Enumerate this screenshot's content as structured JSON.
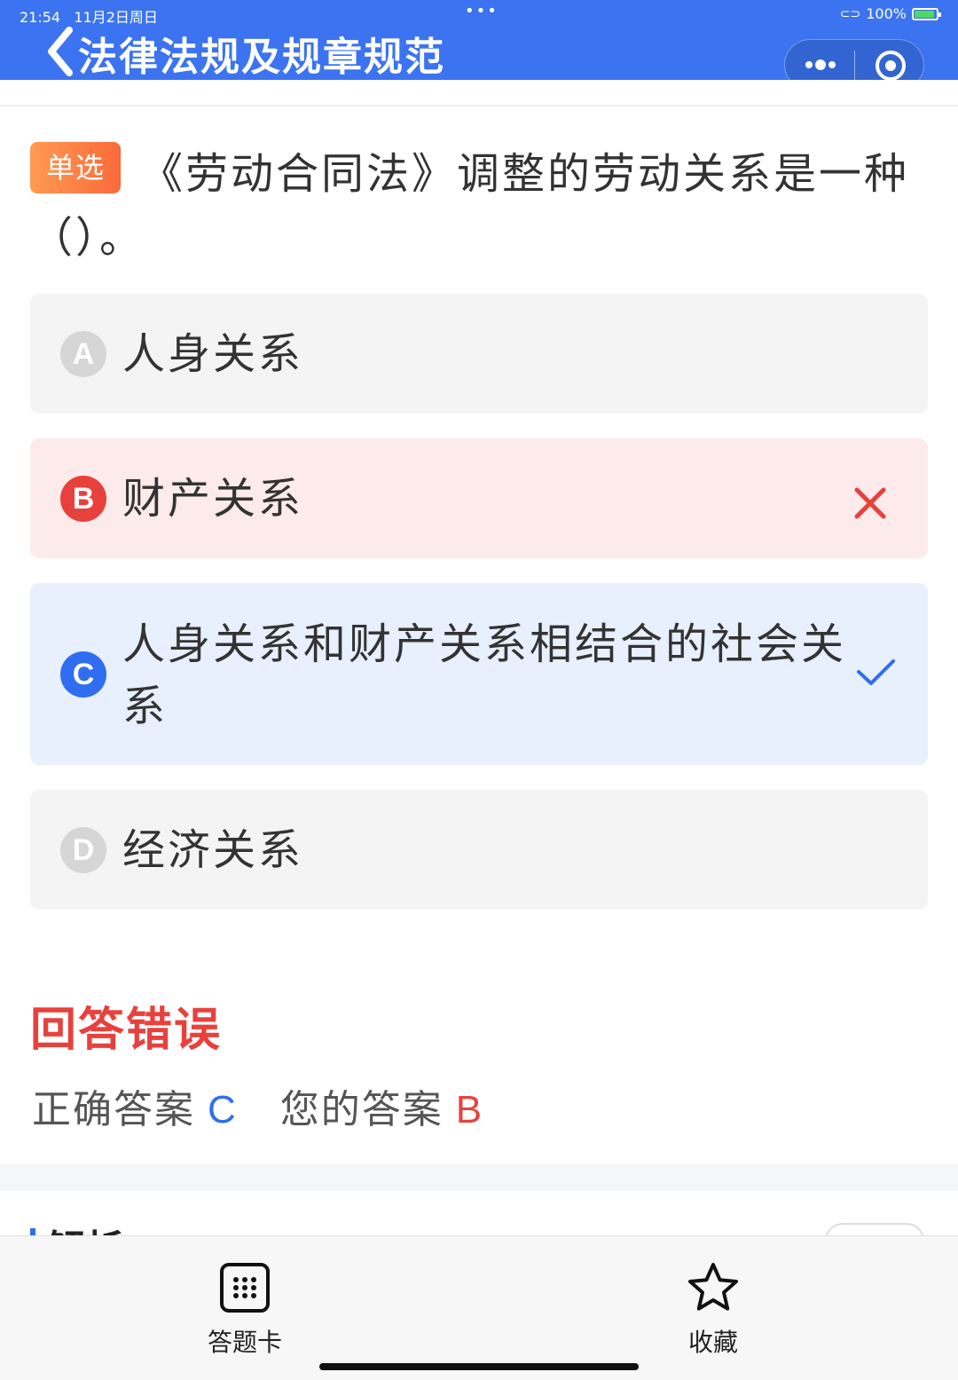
{
  "status_bar": {
    "time": "21:54",
    "date": "11月2日周日",
    "battery": "100%"
  },
  "header": {
    "title": "法律法规及规章规范",
    "color": "#3b73f0"
  },
  "question": {
    "type_label": "单选",
    "text": "《劳动合同法》调整的劳动关系是一种（）。"
  },
  "options": [
    {
      "letter": "A",
      "text": "人身关系",
      "state": "neutral"
    },
    {
      "letter": "B",
      "text": "财产关系",
      "state": "wrong"
    },
    {
      "letter": "C",
      "text": "人身关系和财产关系相结合的社会关系",
      "state": "correct"
    },
    {
      "letter": "D",
      "text": "经济关系",
      "state": "neutral"
    }
  ],
  "result": {
    "title": "回答错误",
    "correct_label": "正确答案",
    "correct_value": "C",
    "your_label": "您的答案",
    "your_value": "B"
  },
  "analysis": {
    "title": "解析"
  },
  "toolbar": {
    "answer_card_label": "答题卡",
    "favorite_label": "收藏"
  },
  "colors": {
    "primary": "#2f6ef0",
    "error": "#e8413d",
    "tag_gradient_start": "#ff9a52",
    "tag_gradient_end": "#fa6a3a"
  }
}
